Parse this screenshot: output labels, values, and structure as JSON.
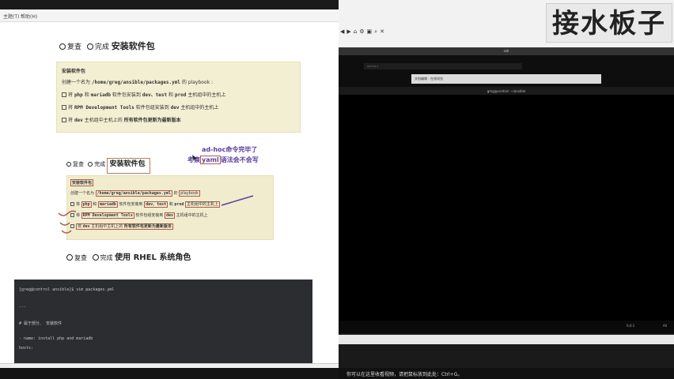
{
  "doc": {
    "menu": [
      "主题(T)",
      "帮助(H)"
    ],
    "task1": {
      "review": "复查",
      "done": "完成",
      "title": "安装软件包"
    },
    "box1": {
      "heading": "安装软件包",
      "intro_pre": "创建一个名为",
      "path": "/home/greg/ansible/packages.yml",
      "intro_mid": "的",
      "intro_post": "playbook :",
      "items": [
        {
          "a": "将",
          "code1": "php",
          "b": "和",
          "code2": "mariadb",
          "c": "软件包安装到",
          "code3": "dev、test",
          "d": "和",
          "code4": "prod",
          "e": "主机组中的主机上"
        },
        {
          "a": "将",
          "code1": "RPM Development Tools",
          "b": "软件包组安装到",
          "code2": "dev",
          "c": "主机组中的主机上"
        },
        {
          "a": "将",
          "code1": "dev",
          "b": "主机组中主机上的",
          "c": "所有软件包更新为最新版本"
        }
      ]
    },
    "task2": {
      "review": "复查",
      "done": "完成",
      "title": "安装软件包"
    },
    "annotation": {
      "line1": "ad-hoc命令完毕了",
      "line2_pre": "考察",
      "line2_mid": "yaml",
      "line2_post": "语法会不会写"
    },
    "box2": {
      "heading": "安装软件包",
      "intro_pre": "创建一个名为",
      "path": "/home/greg/ansible/packages.yml",
      "intro_mid": "的",
      "intro_post": "playbook",
      "items": [
        {
          "a": "将",
          "code1": "php",
          "b": "和",
          "code2": "mariadb",
          "c": "软件包安装到",
          "code3": "dev、test",
          "d": "和",
          "code4": "prod",
          "e": "主机组中的主机上"
        },
        {
          "a": "将",
          "code1": "RPM Development Tools",
          "b": "软件包组安装到",
          "code2": "dev",
          "c": "主机组中的主机上"
        },
        {
          "a": "将",
          "code1": "dev",
          "b": "主机组中主机上的",
          "c": "所有软件包更新为最新版本"
        }
      ]
    },
    "task3": {
      "review": "复查",
      "done": "完成",
      "title": "使用 RHEL 系统角色"
    },
    "terminal": {
      "lines": [
        "[greg@control ansible]$ vim packages.yml",
        "---",
        "# 属于部分、 安装软件",
        "- name: install php and mariadb",
        "  hosts:"
      ]
    }
  },
  "right": {
    "watermark": "接水板子",
    "inner_title": "ssh",
    "address": "127.0.0.1",
    "tab_label": "文档编辑 - 在线浏览",
    "editor_title": "greg@control: ~/ansible",
    "editor_position": "0,0-1",
    "editor_scroll": "All",
    "notification": "你可以在这里收看视频，请把鼠标放到此处：Ctrl+G。"
  }
}
